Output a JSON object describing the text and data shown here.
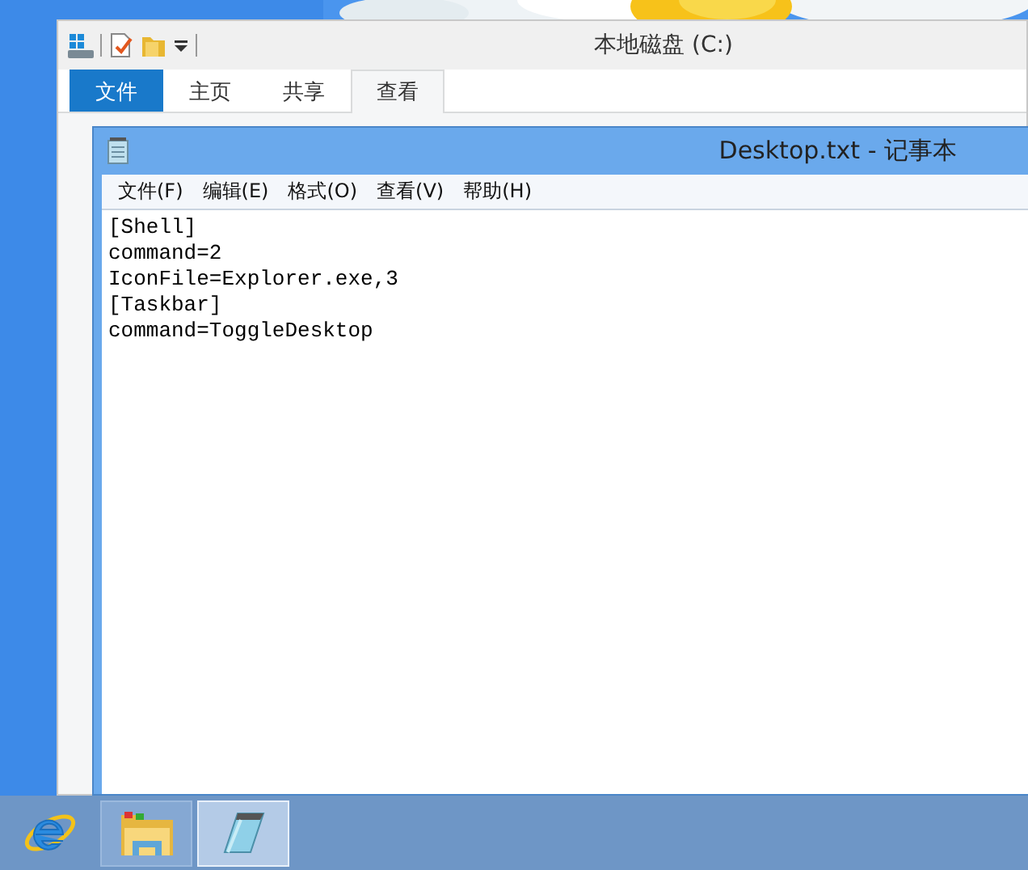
{
  "explorer": {
    "title": "本地磁盘 (C:)",
    "ribbon_tabs": [
      {
        "label": "文件",
        "kind": "file",
        "selected": false
      },
      {
        "label": "主页",
        "kind": "tab",
        "selected": false
      },
      {
        "label": "共享",
        "kind": "tab",
        "selected": false
      },
      {
        "label": "查看",
        "kind": "tab",
        "selected": true
      }
    ]
  },
  "notepad": {
    "title": "Desktop.txt - 记事本",
    "menu": [
      "文件(F)",
      "编辑(E)",
      "格式(O)",
      "查看(V)",
      "帮助(H)"
    ],
    "text_lines": [
      "[Shell]",
      "command=2",
      "IconFile=Explorer.exe,3",
      "[Taskbar]",
      "command=ToggleDesktop"
    ]
  },
  "taskbar": {
    "items": [
      {
        "kind": "browser",
        "open": false,
        "selected": false
      },
      {
        "kind": "explorer",
        "open": true,
        "selected": false
      },
      {
        "kind": "notepad",
        "open": true,
        "selected": true
      }
    ]
  }
}
